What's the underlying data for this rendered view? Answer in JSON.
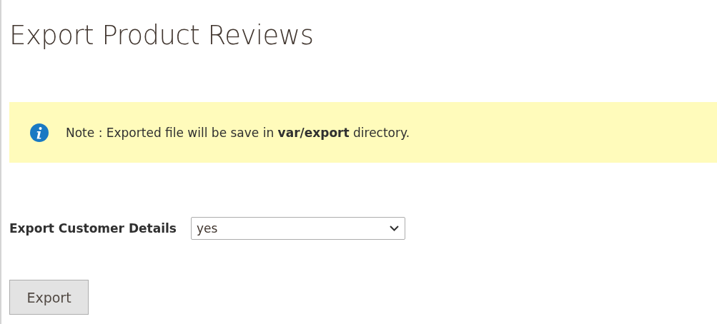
{
  "page_title": "Export Product Reviews",
  "notice": {
    "text": "Note : Exported file will be save in **var/export** directory."
  },
  "form": {
    "label": "Export Customer Details",
    "select_value": "yes"
  },
  "buttons": [
    {
      "label": "Export"
    }
  ]
}
